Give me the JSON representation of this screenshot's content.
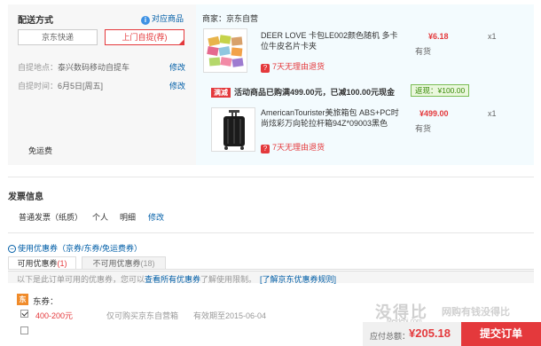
{
  "shipping": {
    "title": "配送方式",
    "match_link": "对应商品",
    "options": [
      "京东快递",
      "上门自提"
    ],
    "selected_suffix": "(荐)",
    "pickup_point_label": "自提地点：",
    "pickup_point_value": "泰兴数码移动自提车",
    "pickup_time_label": "自提时间：",
    "pickup_time_value": "6月5日[周五]",
    "modify": "修改",
    "free_shipping": "免运费"
  },
  "merchant": {
    "label": "商家：京东自营"
  },
  "items": [
    {
      "name": "DEER LOVE 卡包LE002颜色随机 多卡位牛皮名片卡夹",
      "price": "¥6.18",
      "qty": "x1",
      "stock": "有货",
      "return_text": "7天无理由退货"
    },
    {
      "name": "AmericanTourister美旅箱包 ABS+PC时尚炫彩万向轮拉杆箱94Z*09003黑色",
      "price": "¥499.00",
      "qty": "x1",
      "stock": "有货",
      "return_text": "7天无理由退货"
    }
  ],
  "promo": {
    "tag": "满减",
    "text": "活动商品已购满499.00元，已减100.00元现金",
    "returned": "返现：¥100.00"
  },
  "invoice": {
    "title": "发票信息",
    "type": "普通发票（纸质）",
    "person": "个人",
    "detail": "明细",
    "modify": "修改"
  },
  "coupon": {
    "header": "使用优惠券（京券/东券/免运费券）",
    "tab_available": "可用优惠券",
    "tab_available_count": "(1)",
    "tab_unavailable": "不可用优惠券",
    "tab_unavailable_count": "(18)",
    "notice_1": "以下是此订单可用的优惠券，您可以",
    "notice_link": "查看所有优惠券",
    "notice_2": "了解使用限制。",
    "rules_link": "[了解京东优惠券规则]",
    "dong_tag": "东",
    "dong_label": "东券：",
    "row": {
      "amount": "400-200元",
      "desc": "仅可购买京东自营箱",
      "validity": "有效期至2015-06-04"
    }
  },
  "footer": {
    "total_label": "应付总额：",
    "total_value": "¥205.18",
    "submit": "提交订单"
  },
  "watermark": {
    "text": "没得比",
    "sub": "网购有钱没得比",
    "domain": "Meidebi.com"
  }
}
